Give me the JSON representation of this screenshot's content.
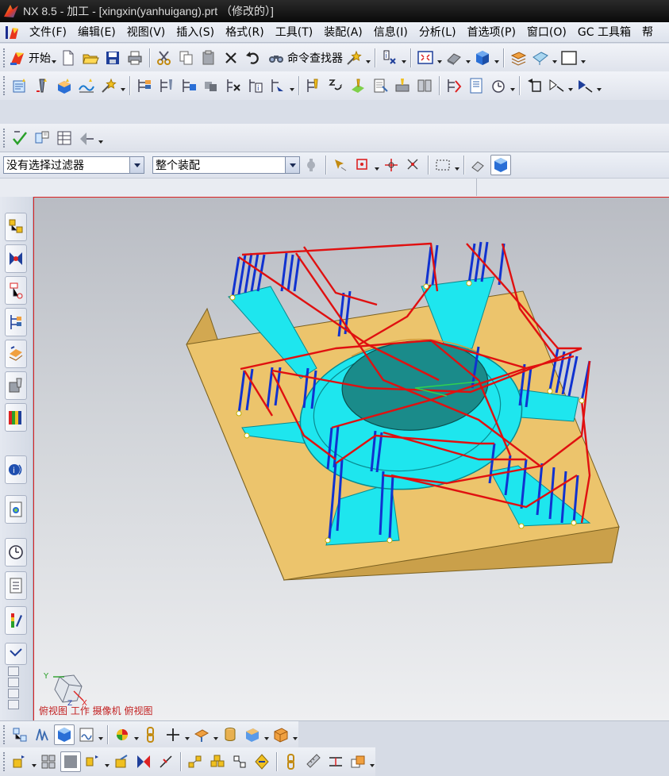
{
  "window": {
    "title": "NX 8.5 - 加工 - [xingxin(yanhuigang).prt （修改的）]"
  },
  "menu": [
    {
      "label": "文件(F)",
      "name": "menu-file"
    },
    {
      "label": "编辑(E)",
      "name": "menu-edit"
    },
    {
      "label": "视图(V)",
      "name": "menu-view"
    },
    {
      "label": "插入(S)",
      "name": "menu-insert"
    },
    {
      "label": "格式(R)",
      "name": "menu-format"
    },
    {
      "label": "工具(T)",
      "name": "menu-tools"
    },
    {
      "label": "装配(A)",
      "name": "menu-assembly"
    },
    {
      "label": "信息(I)",
      "name": "menu-info"
    },
    {
      "label": "分析(L)",
      "name": "menu-analysis"
    },
    {
      "label": "首选项(P)",
      "name": "menu-preferences"
    },
    {
      "label": "窗口(O)",
      "name": "menu-window"
    },
    {
      "label": "GC 工具箱",
      "name": "menu-gc-toolbox"
    },
    {
      "label": "帮",
      "name": "menu-help"
    }
  ],
  "standard_toolbar": {
    "start_label": "开始",
    "command_finder_label": "命令查找器"
  },
  "filter_bar": {
    "selection_filter": "没有选择过滤器",
    "scope": "整个装配"
  },
  "viewport": {
    "view_label": "俯视图 工作 摄像机 俯视图",
    "triad": {
      "x_label": "X",
      "y_label": "Y",
      "z_label": "Z"
    }
  },
  "colors": {
    "part_top": "#ecc46c",
    "part_side": "#d2a851",
    "cavity_cyan": "#1ee6ee",
    "tool_path_red": "#e01010",
    "tool_path_blue": "#1032d0"
  }
}
